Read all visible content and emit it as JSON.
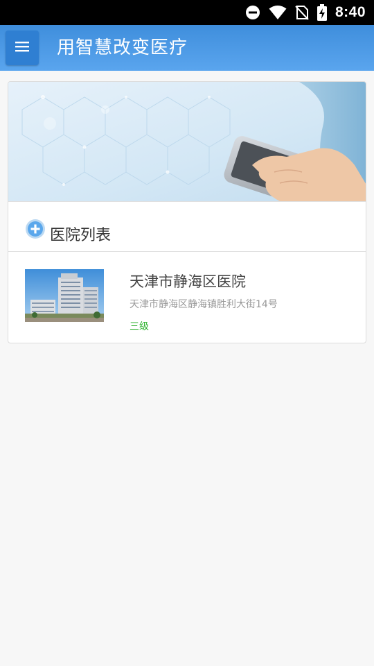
{
  "status_bar": {
    "time": "8:40",
    "icons": [
      "do-not-disturb-icon",
      "wifi-icon",
      "no-sim-icon",
      "battery-charging-icon"
    ]
  },
  "app_bar": {
    "menu_icon": "hamburger-menu-icon",
    "title": "用智慧改变医疗"
  },
  "section": {
    "icon": "plus-circle-icon",
    "title": "医院列表"
  },
  "hospitals": [
    {
      "name": "天津市静海区医院",
      "address": "天津市静海区静海镇胜利大街14号",
      "level": "三级"
    }
  ],
  "colors": {
    "app_bar": "#4a9be6",
    "accent_level": "#2cb12c",
    "background": "#f7f7f7"
  }
}
